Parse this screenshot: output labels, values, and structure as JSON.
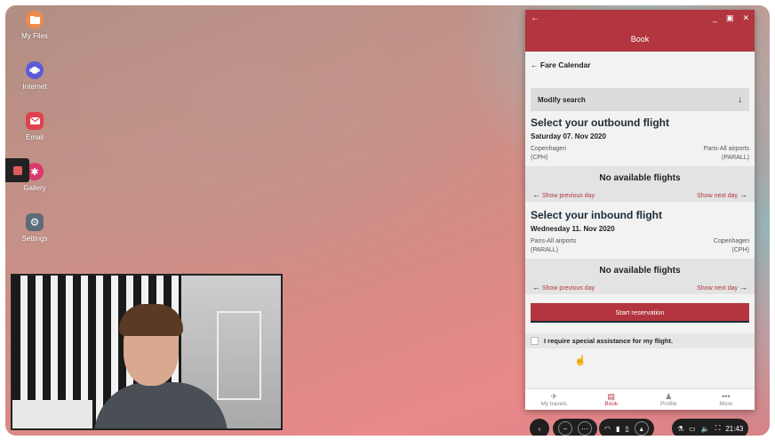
{
  "desktop": {
    "icons": [
      {
        "label": "My Files",
        "icon": "folder-icon",
        "color": "#f08a4b"
      },
      {
        "label": "Internet",
        "icon": "planet-icon",
        "color": "#5b5bd6"
      },
      {
        "label": "Email",
        "icon": "mail-icon",
        "color": "#e0414d"
      },
      {
        "label": "Gallery",
        "icon": "flower-icon",
        "color": "#d93a6d"
      },
      {
        "label": "Settings",
        "icon": "gear-icon",
        "color": "#5d6b78"
      }
    ]
  },
  "app": {
    "titlebar": {
      "back": "←",
      "minimize": "_",
      "maximize": "▣",
      "close": "✕"
    },
    "header_title": "Book",
    "back_link": "Fare Calendar",
    "modify_search": "Modify search",
    "outbound": {
      "heading": "Select your outbound flight",
      "date": "Saturday 07. Nov 2020",
      "from_city": "Copenhagen",
      "from_code": "(CPH)",
      "to_city": "Paris-All airports",
      "to_code": "(PARALL)",
      "no_flights": "No available flights",
      "prev_day": "Show previous day",
      "next_day": "Show next day"
    },
    "inbound": {
      "heading": "Select your inbound flight",
      "date": "Wednesday 11. Nov 2020",
      "from_city": "Paris-All airports",
      "from_code": "(PARALL)",
      "to_city": "Copenhagen",
      "to_code": "(CPH)",
      "no_flights": "No available flights",
      "prev_day": "Show previous day",
      "next_day": "Show next day"
    },
    "start_reservation": "Start reservation",
    "special_assistance": "I require special assistance for my flight.",
    "bottom_nav": [
      {
        "label": "My travels",
        "icon": "plane-icon",
        "glyph": "✈"
      },
      {
        "label": "Book",
        "icon": "ticket-icon",
        "glyph": "▤",
        "active": true
      },
      {
        "label": "Profile",
        "icon": "person-icon",
        "glyph": "♟"
      },
      {
        "label": "More",
        "icon": "more-icon",
        "glyph": "•••"
      }
    ],
    "accent_color": "#b2353f"
  },
  "shelf": {
    "clock": "21:43"
  }
}
